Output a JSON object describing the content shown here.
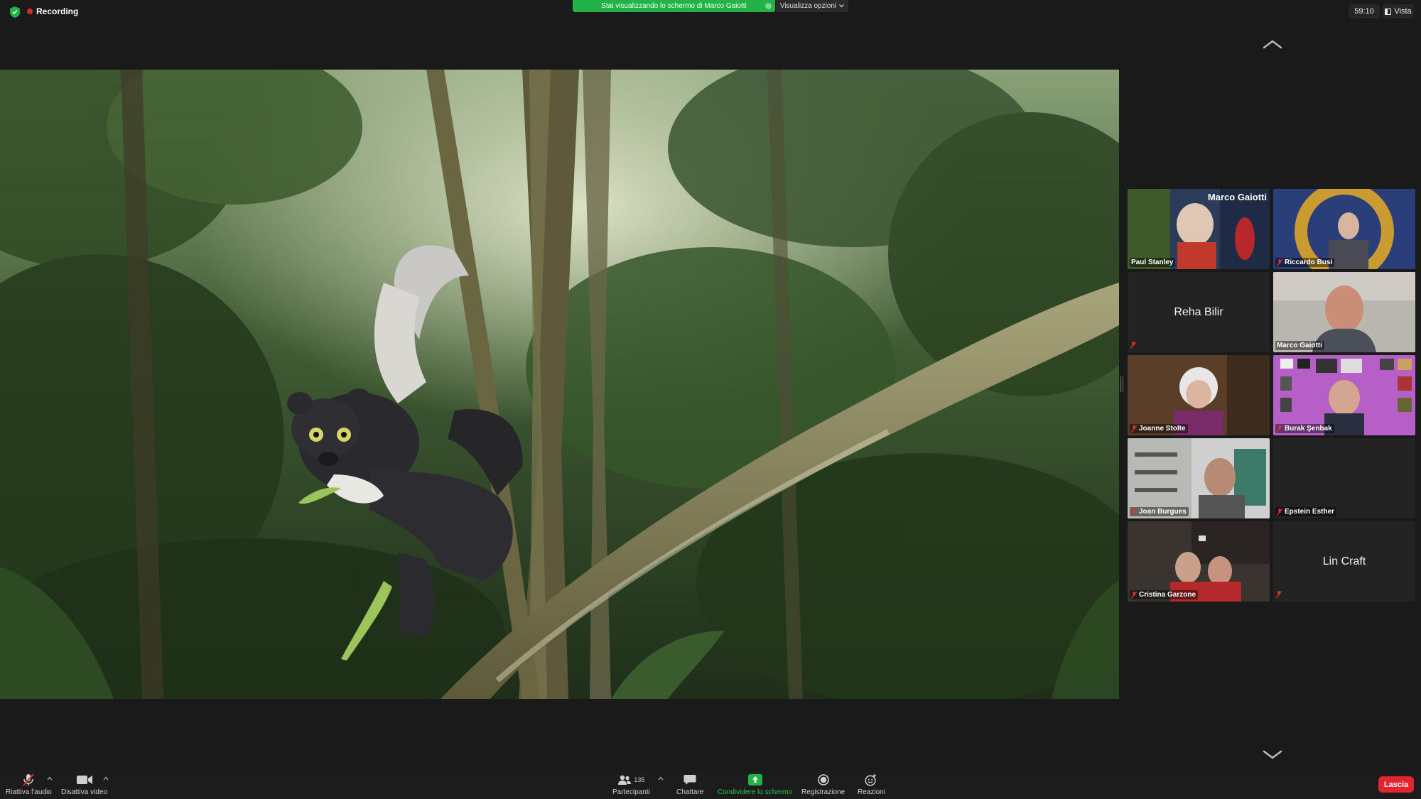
{
  "top": {
    "recording_label": "Recording",
    "share_banner": "Stai visualizzando lo schermo di Marco Gaiotti",
    "view_options": "Visualizza opzioni",
    "timer": "59:10",
    "view_label": "Vista"
  },
  "participants": [
    {
      "name": "Paul Stanley",
      "muted": false,
      "video": true,
      "overlay_title": "Marco Gaiotti"
    },
    {
      "name": "Riccardo Busi",
      "muted": true,
      "video": true
    },
    {
      "name": "Reha Bilir",
      "muted": true,
      "video": false
    },
    {
      "name": "Marco Gaiotti",
      "muted": false,
      "video": true,
      "active": true
    },
    {
      "name": "Joanne Stolte",
      "muted": true,
      "video": true
    },
    {
      "name": "Burak Şenbak",
      "muted": true,
      "video": true
    },
    {
      "name": "Joan Burgues",
      "muted": true,
      "video": true
    },
    {
      "name": "Epstein Esther",
      "muted": true,
      "video": false
    },
    {
      "name": "Cristina Garzone",
      "muted": true,
      "video": true
    },
    {
      "name": "Lin Craft",
      "muted": true,
      "video": false
    }
  ],
  "toolbar": {
    "audio": "Riattiva l'audio",
    "video": "Disattiva video",
    "participants": "Partecipanti",
    "participants_count": "135",
    "chat": "Chattare",
    "share": "Condividere lo schermo",
    "record": "Registrazione",
    "reactions": "Reazioni",
    "leave": "Lascia"
  },
  "colors": {
    "share_green": "#23b247",
    "leave_red": "#e0252e",
    "active_speaker": "#e6e64a"
  }
}
